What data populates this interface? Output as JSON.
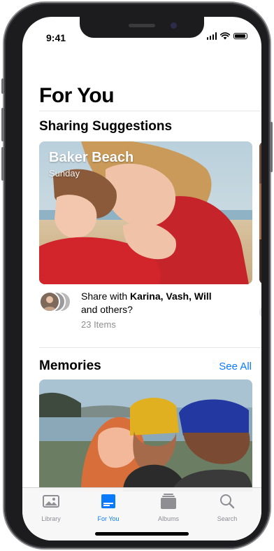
{
  "status_bar": {
    "time": "9:41"
  },
  "page": {
    "title": "For You"
  },
  "sharing": {
    "section_title": "Sharing Suggestions",
    "card": {
      "title": "Baker Beach",
      "subtitle": "Sunday"
    },
    "share_prefix": "Share with ",
    "share_names": "Karina, Vash, Will",
    "share_suffix": "and others?",
    "item_count": "23 Items"
  },
  "memories": {
    "section_title": "Memories",
    "see_all": "See All"
  },
  "tabbar": {
    "items": [
      {
        "label": "Library",
        "icon": "photo-icon",
        "active": false
      },
      {
        "label": "For You",
        "icon": "for-you-icon",
        "active": true
      },
      {
        "label": "Albums",
        "icon": "albums-icon",
        "active": false
      },
      {
        "label": "Search",
        "icon": "search-icon",
        "active": false
      }
    ]
  },
  "colors": {
    "accent": "#0a7aff",
    "label_gray": "#8e8e93",
    "divider": "#e5e5ea"
  }
}
